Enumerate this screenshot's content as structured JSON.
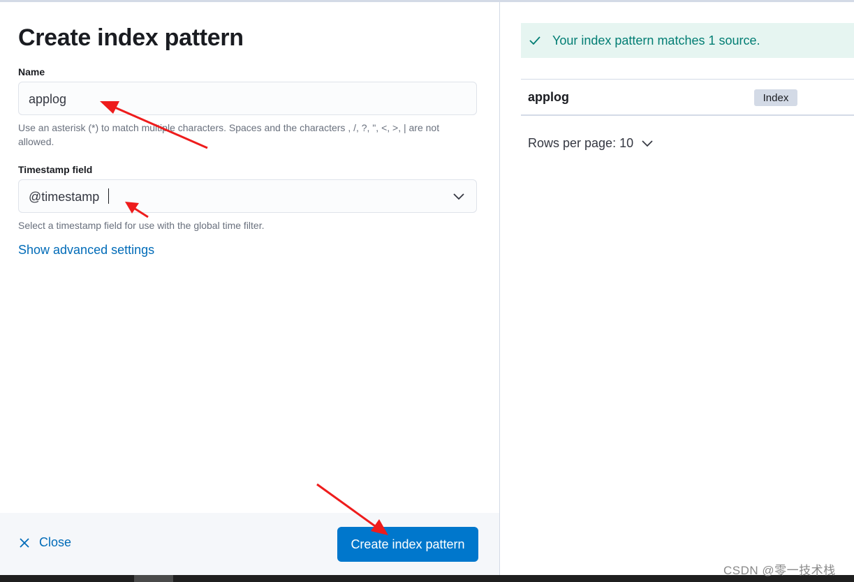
{
  "left": {
    "title": "Create index pattern",
    "name_label": "Name",
    "name_value": "applog",
    "name_help": "Use an asterisk (*) to match multiple characters. Spaces and the characters , /, ?, \", <, >, | are not allowed.",
    "timestamp_label": "Timestamp field",
    "timestamp_value": "@timestamp",
    "timestamp_help": "Select a timestamp field for use with the global time filter.",
    "advanced_link": "Show advanced settings"
  },
  "footer": {
    "close_label": "Close",
    "create_label": "Create index pattern"
  },
  "right": {
    "callout_text": "Your index pattern matches 1 source.",
    "rows": [
      {
        "name": "applog",
        "badge": "Index"
      }
    ],
    "rows_per_page": "Rows per page: 10"
  },
  "watermark": "CSDN @零一技术栈",
  "icons": {
    "close": "close-icon",
    "check": "check-icon",
    "chevron": "chevron-down-icon"
  },
  "colors": {
    "primary": "#0077cc",
    "link": "#006bb8",
    "success_bg": "#e6f5f1",
    "success_text": "#017d73",
    "annotation_arrow": "#ee1c1c"
  }
}
